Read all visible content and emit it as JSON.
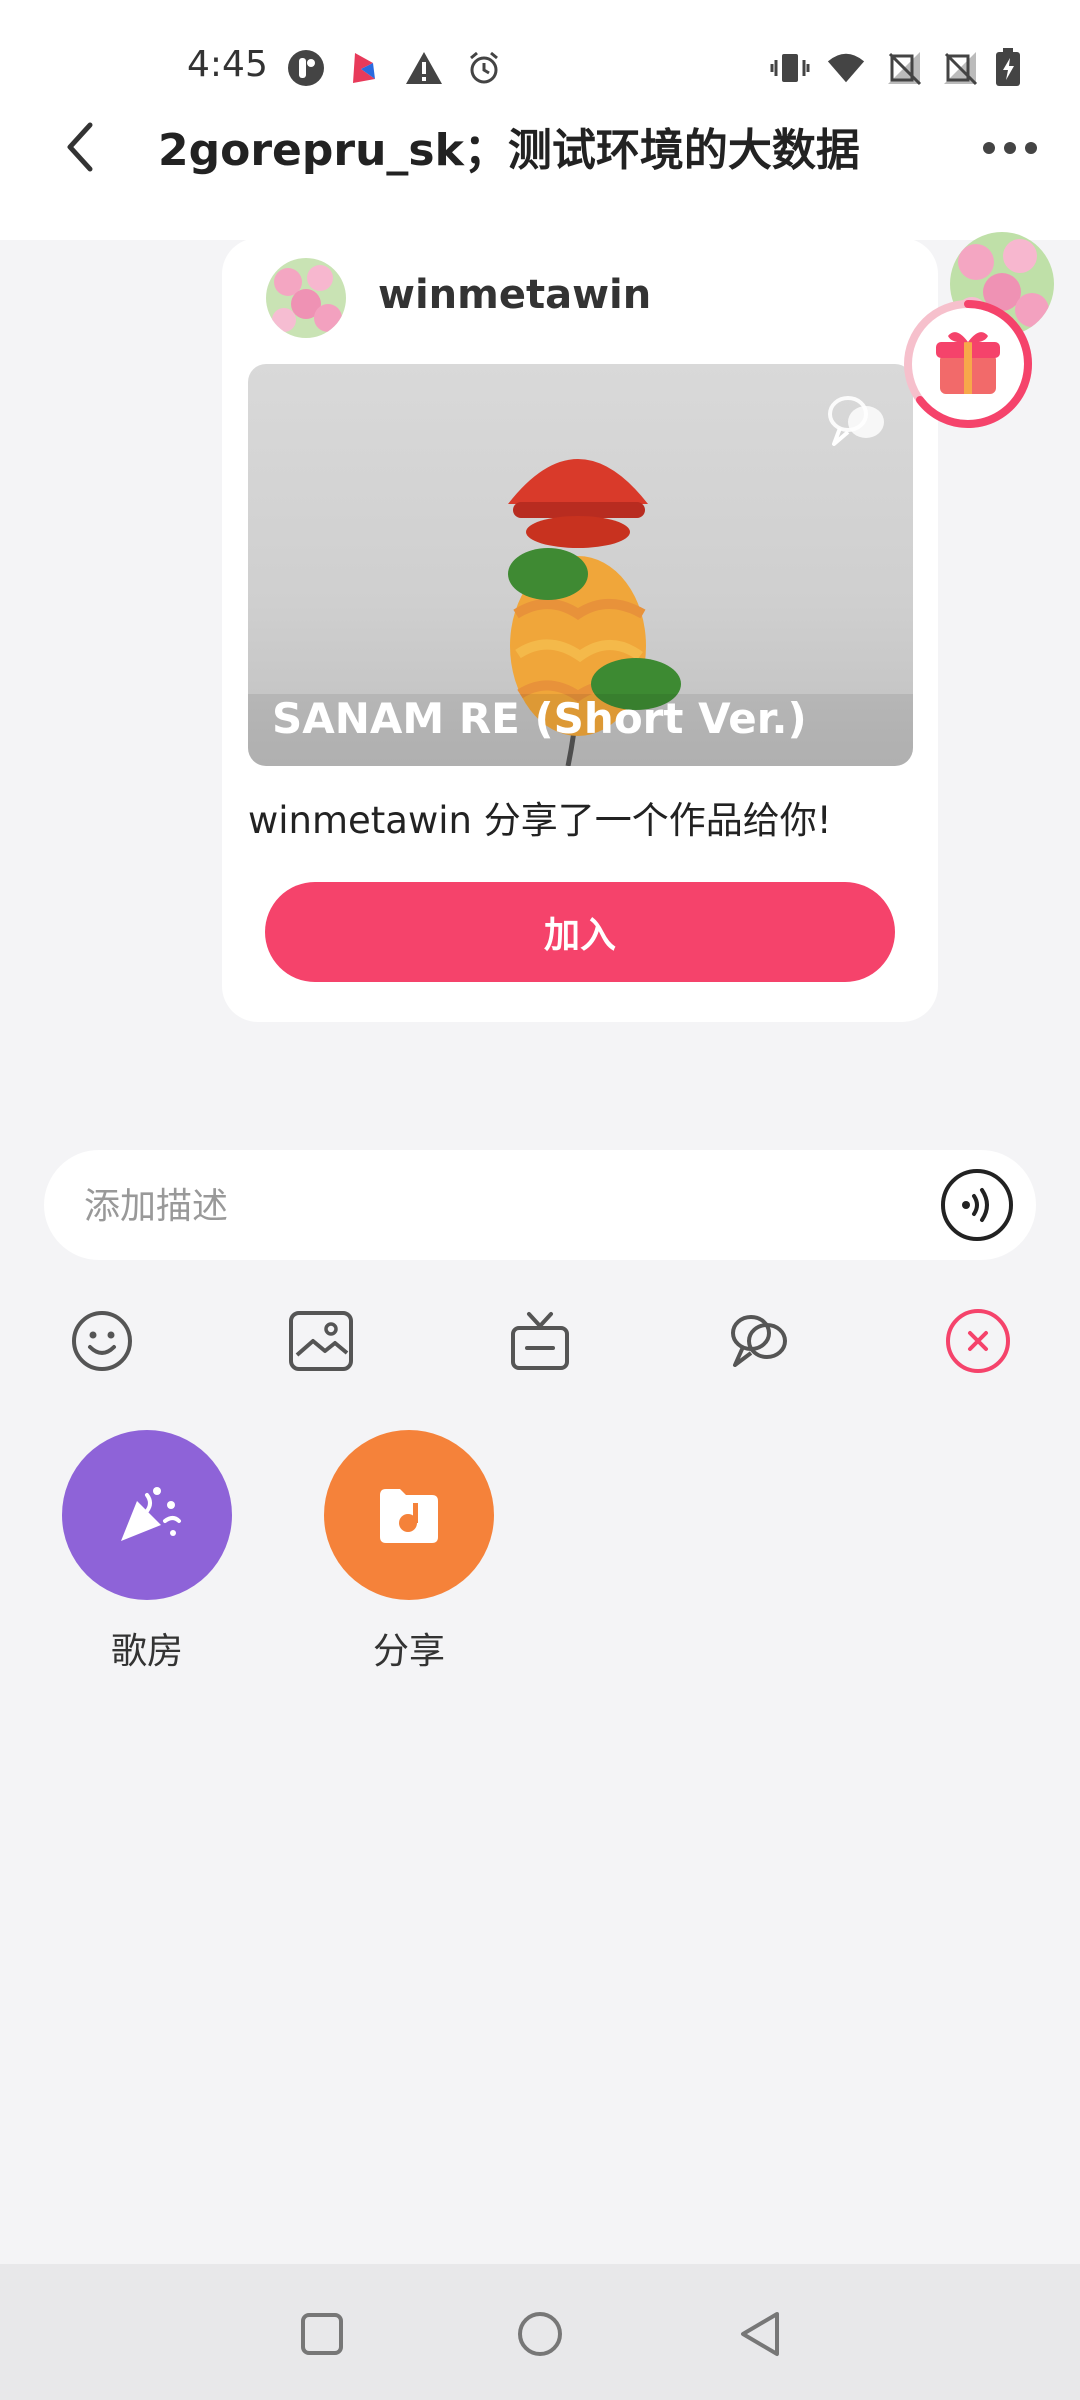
{
  "status_bar": {
    "time": "4:45"
  },
  "header": {
    "title": "2gorepru_sk；测试环境的大数据"
  },
  "share_card": {
    "username": "winmetawin",
    "song_title": "SANAM RE (Short Ver.)",
    "description": "winmetawin 分享了一个作品给你!",
    "join_label": "加入"
  },
  "composer": {
    "placeholder": "添加描述"
  },
  "actions": [
    {
      "label": "歌房",
      "color": "#8e63d8"
    },
    {
      "label": "分享",
      "color": "#f5823a"
    }
  ],
  "colors": {
    "accent": "#f5436b",
    "background": "#f4f4f6"
  }
}
